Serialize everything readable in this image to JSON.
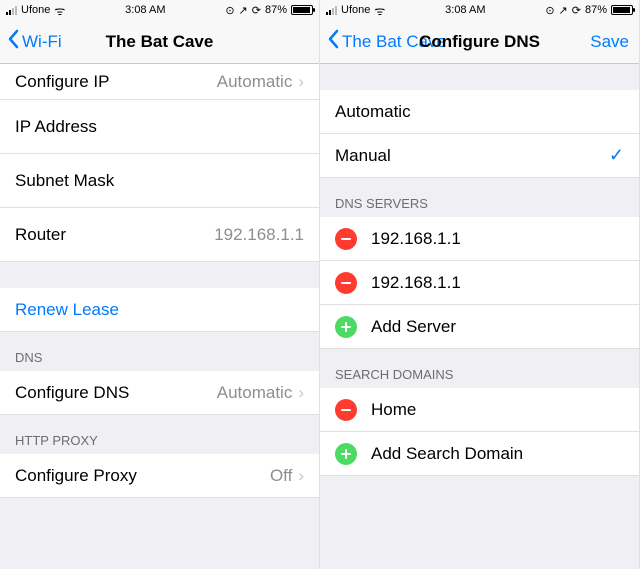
{
  "statusbar": {
    "carrier": "Ufone",
    "time": "3:08 AM",
    "battery_pct": "87%"
  },
  "left": {
    "back_label": "Wi-Fi",
    "title": "The Bat Cave",
    "rows": {
      "configure_ip_label": "Configure IP",
      "configure_ip_value": "Automatic",
      "ip_address_label": "IP Address",
      "subnet_mask_label": "Subnet Mask",
      "router_label": "Router",
      "router_value": "192.168.1.1",
      "renew_lease": "Renew Lease",
      "dns_header": "DNS",
      "configure_dns_label": "Configure DNS",
      "configure_dns_value": "Automatic",
      "http_proxy_header": "HTTP PROXY",
      "configure_proxy_label": "Configure Proxy",
      "configure_proxy_value": "Off"
    }
  },
  "right": {
    "back_label": "The Bat Cave",
    "title": "Configure DNS",
    "save_label": "Save",
    "options": {
      "automatic": "Automatic",
      "manual": "Manual"
    },
    "dns_servers_header": "DNS SERVERS",
    "servers": [
      "192.168.1.1",
      "192.168.1.1"
    ],
    "add_server": "Add Server",
    "search_domains_header": "SEARCH DOMAINS",
    "domains": [
      "Home"
    ],
    "add_domain": "Add Search Domain"
  }
}
